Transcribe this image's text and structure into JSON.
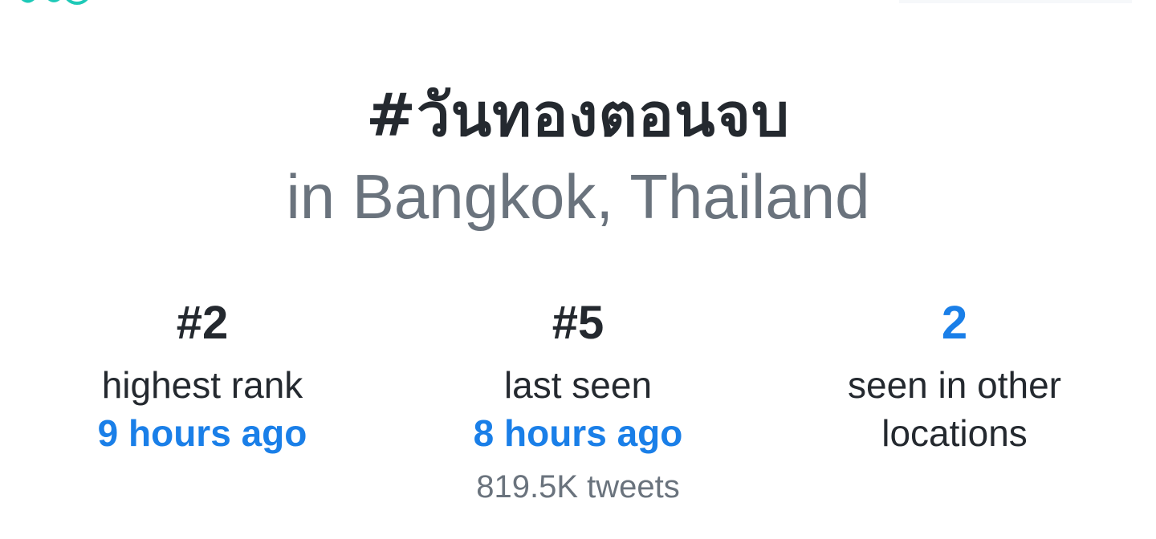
{
  "hashtag": "#วันทองตอนจบ",
  "location": "in Bangkok, Thailand",
  "stats": {
    "highest": {
      "value": "#2",
      "label": "highest rank",
      "time": "9 hours ago"
    },
    "last": {
      "value": "#5",
      "label": "last seen",
      "time": "8 hours ago",
      "tweets": "819.5K tweets"
    },
    "other": {
      "value": "2",
      "label": "seen in other locations"
    }
  },
  "colors": {
    "accent": "#1a7fe8",
    "text": "#24292f",
    "muted": "#6a737d",
    "logo": "#1dc9b7"
  },
  "icons": {
    "logo": "app-logo-icon"
  }
}
